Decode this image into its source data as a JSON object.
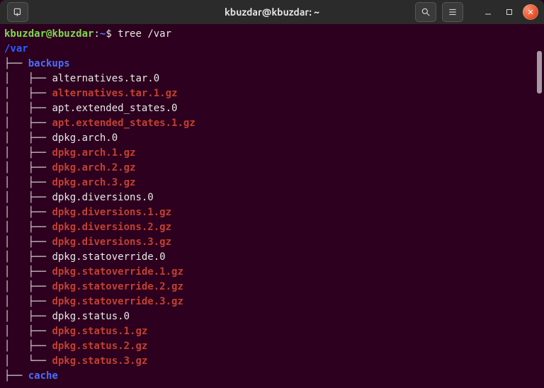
{
  "window": {
    "title": "kbuzdar@kbuzdar: ~"
  },
  "prompt": {
    "userhost": "kbuzdar@kbuzdar",
    "sep": ":",
    "cwd": "~",
    "dollar": "$",
    "command": "tree /var"
  },
  "tree": {
    "root": "/var",
    "children": [
      {
        "name": "backups",
        "type": "dir",
        "children": [
          {
            "name": "alternatives.tar.0",
            "type": "file"
          },
          {
            "name": "alternatives.tar.1.gz",
            "type": "gz"
          },
          {
            "name": "apt.extended_states.0",
            "type": "file"
          },
          {
            "name": "apt.extended_states.1.gz",
            "type": "gz"
          },
          {
            "name": "dpkg.arch.0",
            "type": "file"
          },
          {
            "name": "dpkg.arch.1.gz",
            "type": "gz"
          },
          {
            "name": "dpkg.arch.2.gz",
            "type": "gz"
          },
          {
            "name": "dpkg.arch.3.gz",
            "type": "gz"
          },
          {
            "name": "dpkg.diversions.0",
            "type": "file"
          },
          {
            "name": "dpkg.diversions.1.gz",
            "type": "gz"
          },
          {
            "name": "dpkg.diversions.2.gz",
            "type": "gz"
          },
          {
            "name": "dpkg.diversions.3.gz",
            "type": "gz"
          },
          {
            "name": "dpkg.statoverride.0",
            "type": "file"
          },
          {
            "name": "dpkg.statoverride.1.gz",
            "type": "gz"
          },
          {
            "name": "dpkg.statoverride.2.gz",
            "type": "gz"
          },
          {
            "name": "dpkg.statoverride.3.gz",
            "type": "gz"
          },
          {
            "name": "dpkg.status.0",
            "type": "file"
          },
          {
            "name": "dpkg.status.1.gz",
            "type": "gz"
          },
          {
            "name": "dpkg.status.2.gz",
            "type": "gz"
          },
          {
            "name": "dpkg.status.3.gz",
            "type": "gz"
          }
        ]
      },
      {
        "name": "cache",
        "type": "dir"
      }
    ]
  }
}
